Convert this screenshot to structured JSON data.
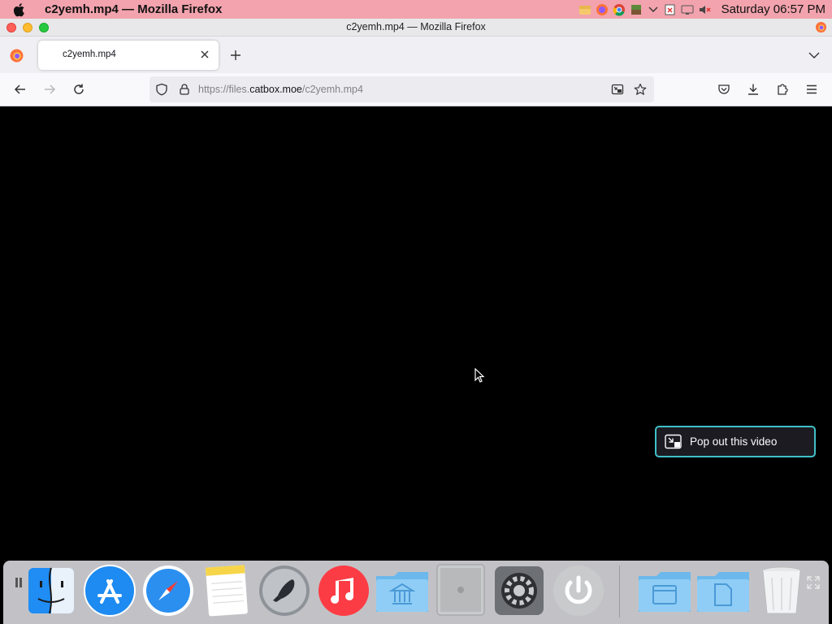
{
  "menubar": {
    "app_title": "c2yemh.mp4 — Mozilla Firefox",
    "clock": "Saturday 06:57 PM",
    "tray_icons": [
      "finder-tray-icon",
      "firefox-tray-icon",
      "chrome-tray-icon",
      "minecraft-tray-icon",
      "chevron-down-icon",
      "flag-icon",
      "display-icon",
      "volume-muted-icon"
    ]
  },
  "window": {
    "title": "c2yemh.mp4 — Mozilla Firefox"
  },
  "tabs": [
    {
      "label": "c2yemh.mp4",
      "active": true
    }
  ],
  "navbar": {
    "url_prefix": "https://files.",
    "url_host": "catbox.moe",
    "url_path": "/c2yemh.mp4"
  },
  "content": {
    "popout_label": "Pop out this video"
  },
  "dock": {
    "items": [
      "finder",
      "app-store",
      "safari",
      "notes",
      "launchpad",
      "music",
      "applications-folder",
      "mac-pro",
      "system-preferences",
      "power",
      "documents-folder",
      "downloads-folder",
      "trash"
    ]
  },
  "colors": {
    "menubar": "#f2a3ad",
    "popout_border": "#40c0c8",
    "video_bg": "#000000"
  }
}
